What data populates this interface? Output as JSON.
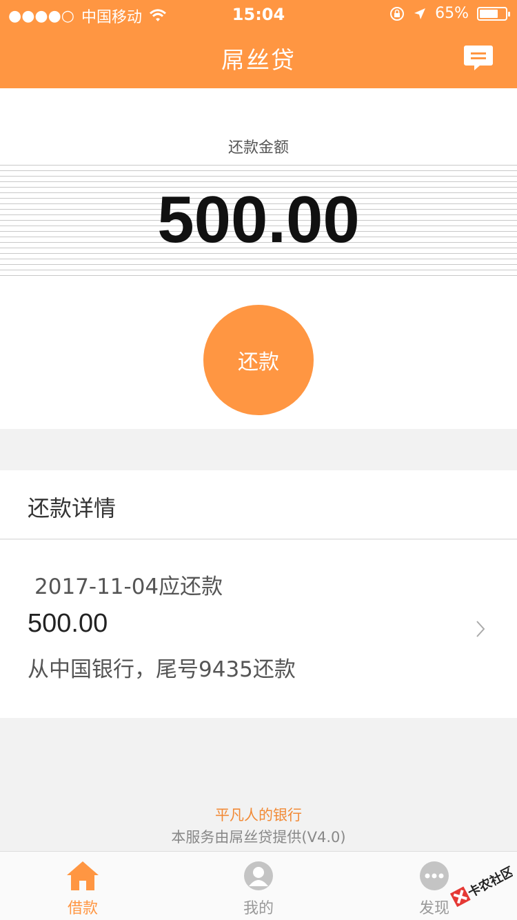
{
  "status_bar": {
    "signal": "●●●●○",
    "carrier": "中国移动",
    "time": "15:04",
    "battery": "65%"
  },
  "header": {
    "title": "屌丝贷",
    "message_icon": "message-icon"
  },
  "repayment": {
    "label": "还款金额",
    "amount": "500.00",
    "button_label": "还款"
  },
  "details": {
    "title": "还款详情",
    "record": {
      "date_text": "2017-11-04应还款",
      "amount": "500.00",
      "bank_text": "从中国银行，尾号9435还款"
    }
  },
  "footer": {
    "slogan": "平凡人的银行",
    "provider": "本服务由屌丝贷提供(V4.0)"
  },
  "tabs": [
    {
      "label": "借款",
      "icon": "home-icon",
      "active": true
    },
    {
      "label": "我的",
      "icon": "user-icon",
      "active": false
    },
    {
      "label": "发现",
      "icon": "more-icon",
      "active": false
    }
  ],
  "watermark": {
    "text": "卡农社区"
  },
  "colors": {
    "accent": "#ff9642",
    "background": "#f2f2f2"
  }
}
